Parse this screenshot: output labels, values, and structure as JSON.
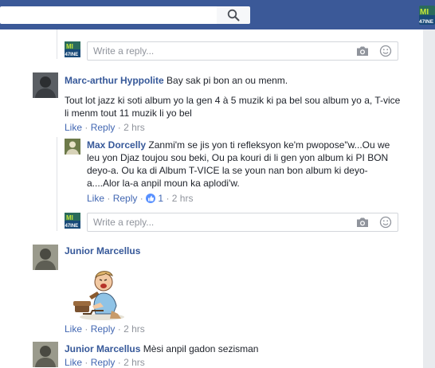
{
  "header": {
    "search_placeholder": "",
    "brand_logo_text_top": "MI",
    "brand_logo_text_bottom": "47INE"
  },
  "reply_box": {
    "placeholder": "Write a reply..."
  },
  "page_avatar": {
    "text_top": "MI",
    "text_bottom": "47INE"
  },
  "comments": [
    {
      "author": "Marc-arthur Hyppolite",
      "first_line": "Bay sak pi bon an ou menm.",
      "text_line1": "Tout lot jazz ki soti album yo la gen 4 à 5 muzik ki pa bel sou album yo a, T-vice",
      "text_line2": "li menm tout 11 muzik li yo bel",
      "like": "Like",
      "reply": "Reply",
      "time": "2 hrs",
      "replies": [
        {
          "author": "Max Dorcelly",
          "text_line1": "Zanmi'm se jis yon ti refleksyon ke'm pwopose\"w...Ou we",
          "text_line2": "leu yon Djaz toujou sou beki, Ou pa kouri di li gen yon album ki PI BON",
          "text_line3": "deyo-a. Ou ka di Album T-VICE la se youn nan bon album ki deyo-",
          "text_line4": "a....Alor la-a anpil moun ka aplodi'w.",
          "like": "Like",
          "reply": "Reply",
          "reaction_count": "1",
          "time": "2 hrs"
        }
      ]
    },
    {
      "author": "Junior Marcellus",
      "text": "",
      "like": "Like",
      "reply": "Reply",
      "time": "2 hrs"
    },
    {
      "author": "Junior Marcellus",
      "text": "Mèsi anpil gadon sezisman",
      "like": "Like",
      "reply": "Reply",
      "time": "2 hrs"
    }
  ],
  "separator": "·",
  "colors": {
    "topbar": "#3b5998",
    "link": "#365899",
    "action_link": "#4267b2",
    "meta_gray": "#90949c",
    "page_bg": "#e9ebee"
  },
  "icons": [
    "search-icon",
    "camera-icon",
    "smiley-icon",
    "like-reaction-icon"
  ]
}
